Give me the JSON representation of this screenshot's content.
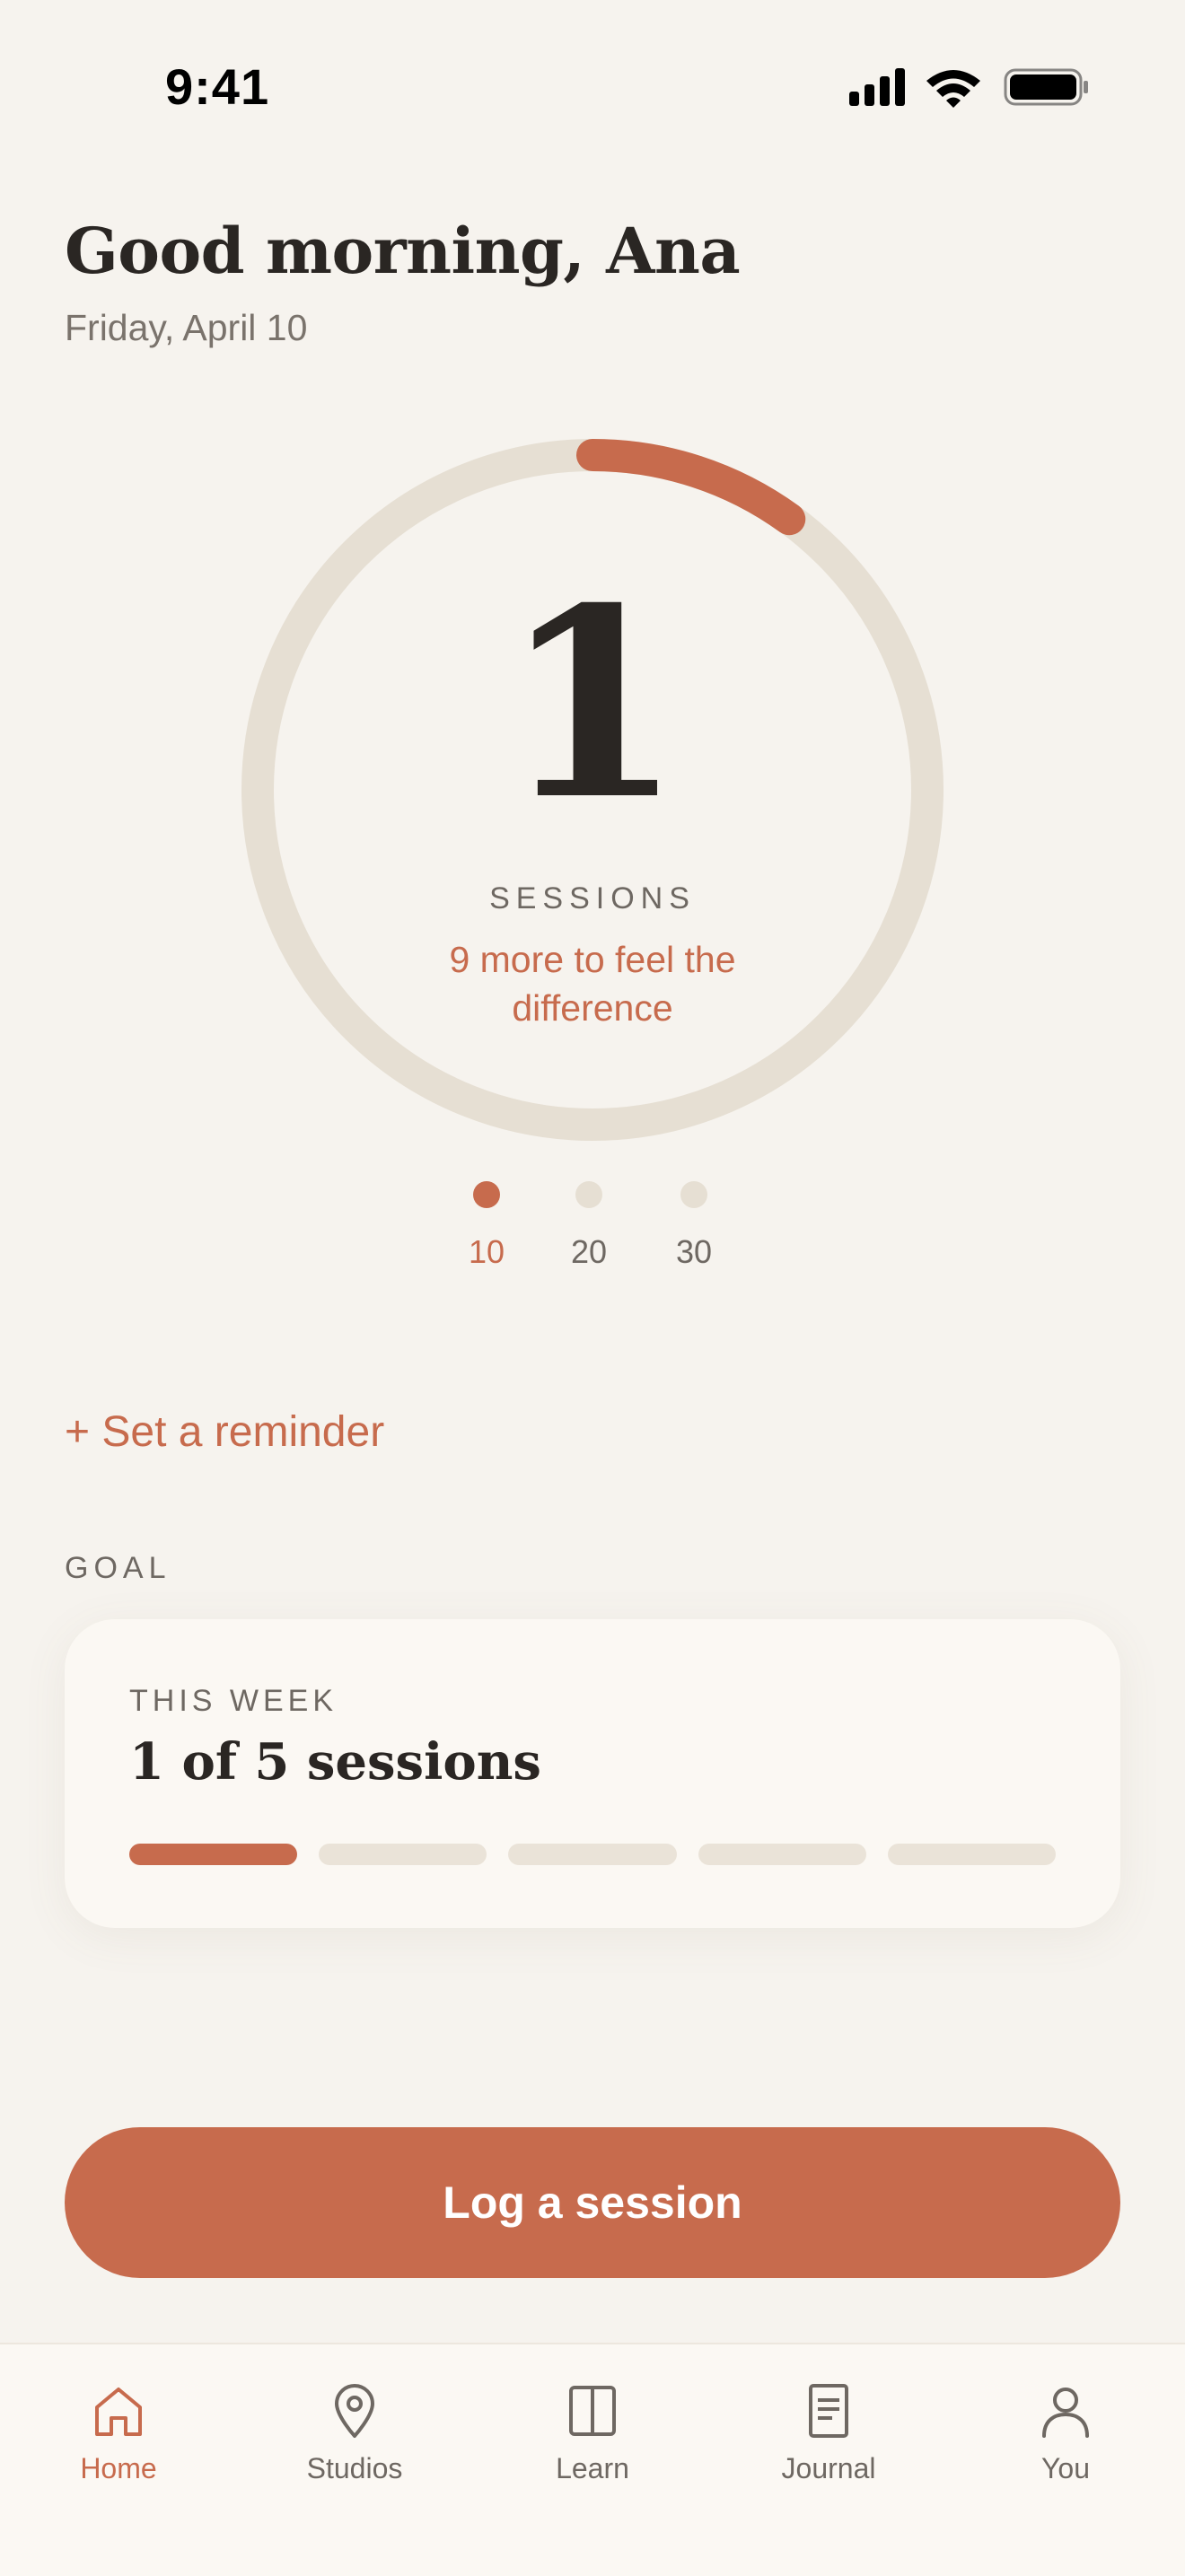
{
  "status_bar": {
    "time": "9:41",
    "icons": [
      "signal-icon",
      "wifi-icon",
      "battery-icon"
    ]
  },
  "header": {
    "greeting": "Good morning, Ana",
    "date": "Friday, April 10"
  },
  "progress": {
    "count": "1",
    "label": "SESSIONS",
    "subtext": "9 more to feel the difference",
    "completed": 1,
    "target": 10,
    "milestones": [
      {
        "label": "10",
        "active": true
      },
      {
        "label": "20",
        "active": false
      },
      {
        "label": "30",
        "active": false
      }
    ]
  },
  "reminder": {
    "label": "+ Set a reminder"
  },
  "goal": {
    "heading": "GOAL",
    "card_label": "THIS WEEK",
    "title": "1 of 5 sessions",
    "completed": 1,
    "total": 5
  },
  "cta": {
    "label": "Log a session"
  },
  "tabs": [
    {
      "label": "Home",
      "icon": "home-icon",
      "active": true
    },
    {
      "label": "Studios",
      "icon": "location-pin-icon",
      "active": false
    },
    {
      "label": "Learn",
      "icon": "book-icon",
      "active": false
    },
    {
      "label": "Journal",
      "icon": "journal-icon",
      "active": false
    },
    {
      "label": "You",
      "icon": "person-icon",
      "active": false
    }
  ],
  "colors": {
    "background": "#F6F3EE",
    "accent": "#C76B4D",
    "track": "#E6DFD3",
    "text": "#2A2623",
    "muted": "#7A736C"
  }
}
